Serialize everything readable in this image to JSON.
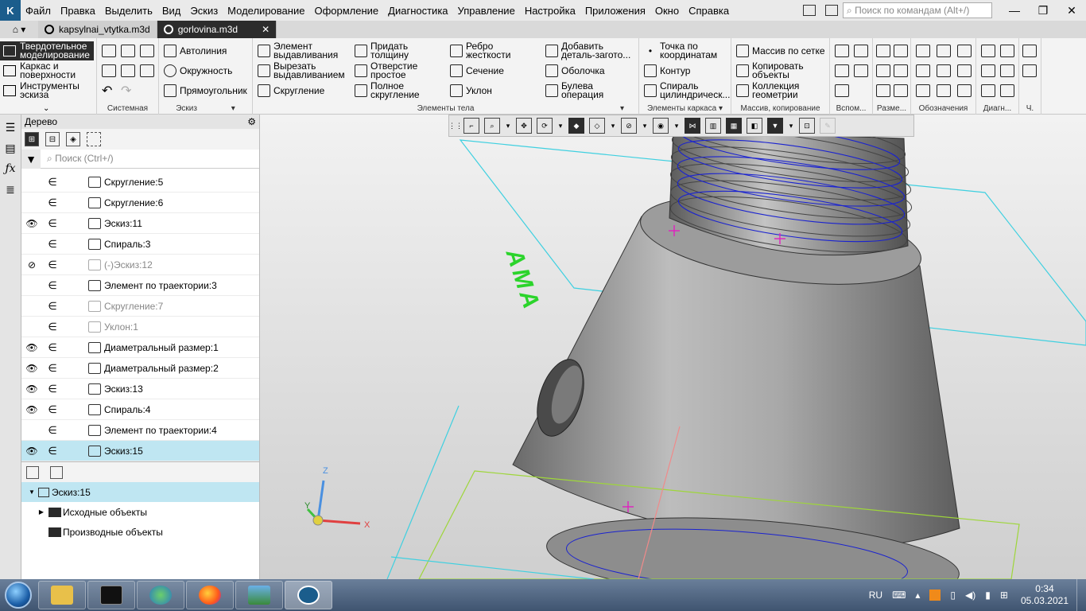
{
  "menu": [
    "Файл",
    "Правка",
    "Выделить",
    "Вид",
    "Эскиз",
    "Моделирование",
    "Оформление",
    "Диагностика",
    "Управление",
    "Настройка",
    "Приложения",
    "Окно",
    "Справка"
  ],
  "command_search_placeholder": "Поиск по командам (Alt+/)",
  "tabs": [
    {
      "label": "kapsylnai_vtytka.m3d",
      "active": false
    },
    {
      "label": "gorlovina.m3d",
      "active": true
    }
  ],
  "ribbon": {
    "modes": [
      "Твердотельное моделирование",
      "Каркас и поверхности",
      "Инструменты эскиза"
    ],
    "sistemnaya": "Системная",
    "eskiz": {
      "title": "Эскиз",
      "items": [
        "Автолиния",
        "Окружность",
        "Прямоугольник"
      ]
    },
    "elementy_tela": {
      "title": "Элементы тела",
      "items": [
        "Элемент выдавливания",
        "Вырезать выдавливанием",
        "Скругление",
        "Придать толщину",
        "Отверстие простое",
        "Полное скругление",
        "Ребро жесткости",
        "Сечение",
        "Уклон",
        "Добавить деталь-загото...",
        "Оболочка",
        "Булева операция"
      ]
    },
    "elementy_karkasa": {
      "title": "Элементы каркаса",
      "items": [
        "Точка по координатам",
        "Контур",
        "Спираль цилиндрическ..."
      ]
    },
    "massivy": {
      "title": "Массив, копирование",
      "items": [
        "Массив по сетке",
        "Копировать объекты",
        "Коллекция геометрии"
      ]
    },
    "small_groups": [
      "Вспом...",
      "Разме...",
      "Обозначения",
      "Диагн...",
      "Ч."
    ]
  },
  "tree_panel": {
    "title": "Дерево",
    "search_placeholder": "Поиск (Ctrl+/)",
    "rows": [
      {
        "label": "Скругление:5",
        "eye": "",
        "muted": false,
        "selected": false
      },
      {
        "label": "Скругление:6",
        "eye": "",
        "muted": false,
        "selected": false
      },
      {
        "label": "Эскиз:11",
        "eye": "👁",
        "muted": false,
        "selected": false
      },
      {
        "label": "Спираль:3",
        "eye": "",
        "muted": false,
        "selected": false
      },
      {
        "label": "(-)Эскиз:12",
        "eye": "⊘",
        "muted": true,
        "selected": false
      },
      {
        "label": "Элемент по траектории:3",
        "eye": "",
        "muted": false,
        "selected": false
      },
      {
        "label": "Скругление:7",
        "eye": "",
        "muted": true,
        "selected": false
      },
      {
        "label": "Уклон:1",
        "eye": "",
        "muted": true,
        "selected": false
      },
      {
        "label": "Диаметральный размер:1",
        "eye": "👁",
        "muted": false,
        "selected": false
      },
      {
        "label": "Диаметральный размер:2",
        "eye": "👁",
        "muted": false,
        "selected": false
      },
      {
        "label": "Эскиз:13",
        "eye": "👁",
        "muted": false,
        "selected": false
      },
      {
        "label": "Спираль:4",
        "eye": "👁",
        "muted": false,
        "selected": false
      },
      {
        "label": "Элемент по траектории:4",
        "eye": "",
        "muted": false,
        "selected": false
      },
      {
        "label": "Эскиз:15",
        "eye": "👁",
        "muted": false,
        "selected": true
      }
    ]
  },
  "properties": {
    "root": "Эскиз:15",
    "children": [
      "Исходные объекты",
      "Производные объекты"
    ]
  },
  "viewport": {
    "axes": {
      "x": "X",
      "y": "Y",
      "z": "Z"
    },
    "annotation_text": "АМА"
  },
  "taskbar": {
    "lang": "RU",
    "time": "0:34",
    "date": "05.03.2021"
  }
}
